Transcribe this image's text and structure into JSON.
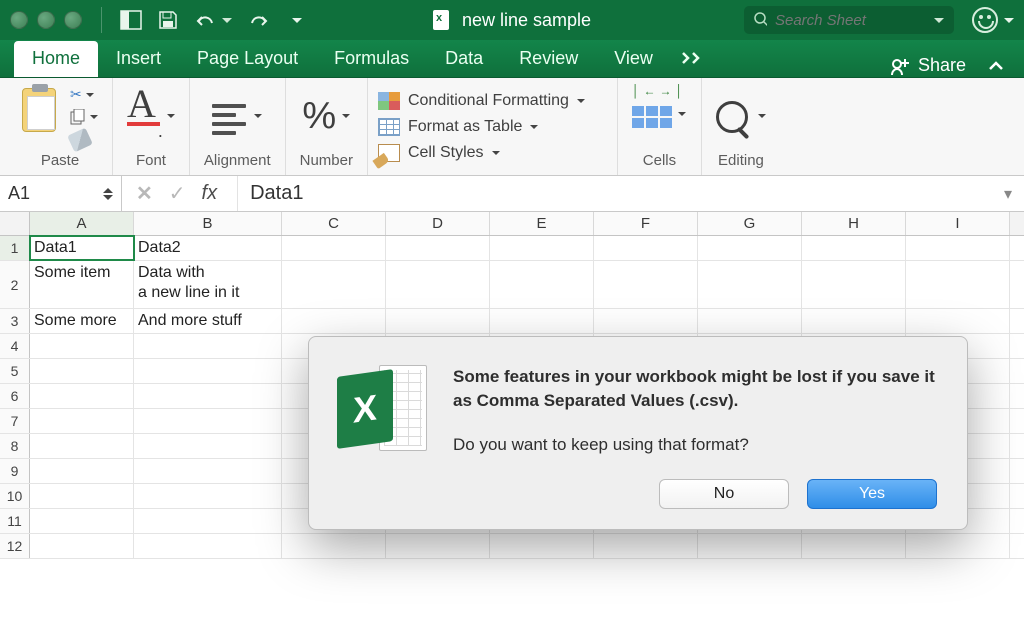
{
  "titlebar": {
    "doc_title": "new line sample",
    "search_placeholder": "Search Sheet"
  },
  "tabs": {
    "items": [
      "Home",
      "Insert",
      "Page Layout",
      "Formulas",
      "Data",
      "Review",
      "View"
    ],
    "active": "Home",
    "share_label": "Share"
  },
  "ribbon": {
    "paste_label": "Paste",
    "font_label": "Font",
    "alignment_label": "Alignment",
    "number_label": "Number",
    "cond_fmt_label": "Conditional Formatting",
    "fmt_table_label": "Format as Table",
    "cell_styles_label": "Cell Styles",
    "cells_label": "Cells",
    "editing_label": "Editing"
  },
  "fxbar": {
    "namebox": "A1",
    "fx_label": "fx",
    "formula_value": "Data1"
  },
  "grid": {
    "columns": [
      "A",
      "B",
      "C",
      "D",
      "E",
      "F",
      "G",
      "H",
      "I"
    ],
    "active_col": "A",
    "active_row": 1,
    "rows": [
      {
        "n": 1,
        "A": "Data1",
        "B": "Data2"
      },
      {
        "n": 2,
        "A": "Some item",
        "B": "Data with\na new line in it"
      },
      {
        "n": 3,
        "A": "Some more",
        "B": "And more stuff"
      },
      {
        "n": 4
      },
      {
        "n": 5
      },
      {
        "n": 6
      },
      {
        "n": 7
      },
      {
        "n": 8
      },
      {
        "n": 9
      },
      {
        "n": 10
      },
      {
        "n": 11
      },
      {
        "n": 12
      }
    ]
  },
  "dialog": {
    "message": "Some features in your workbook might be lost if you save it as Comma Separated Values (.csv).",
    "question": "Do you want to keep using that format?",
    "no_label": "No",
    "yes_label": "Yes"
  }
}
